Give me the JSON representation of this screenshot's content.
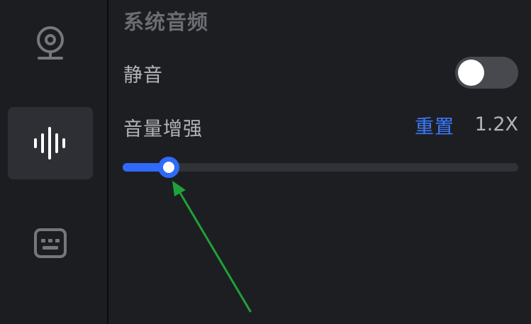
{
  "sidebar": {
    "items": [
      {
        "icon": "webcam-icon",
        "active": false
      },
      {
        "icon": "audio-waveform-icon",
        "active": true
      },
      {
        "icon": "keyboard-icon",
        "active": false
      }
    ]
  },
  "section": {
    "title": "系统音频"
  },
  "mute": {
    "label": "静音",
    "enabled": false
  },
  "volume_boost": {
    "label": "音量增强",
    "reset_label": "重置",
    "value_label": "1.2X",
    "slider_fraction": 0.117
  },
  "colors": {
    "accent": "#2f6af8",
    "link": "#3a7afc",
    "arrow": "#1ea13a"
  }
}
